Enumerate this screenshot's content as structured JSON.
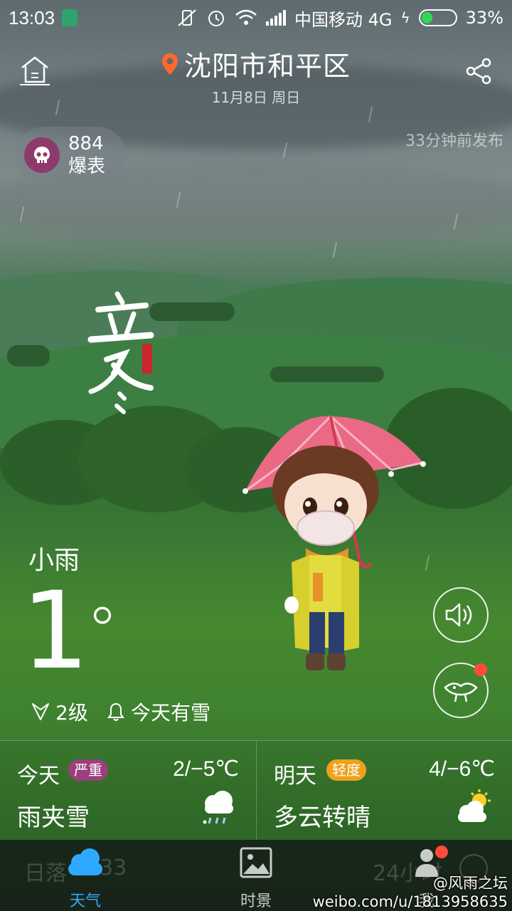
{
  "status_bar": {
    "time": "13:03",
    "carrier": "中国移动 4G",
    "battery": "33%",
    "battery_level": 0.33
  },
  "header": {
    "location": "沈阳市和平区",
    "date": "11月8日 周日",
    "published": "33分钟前发布"
  },
  "aqi": {
    "value": "884",
    "label": "爆表",
    "color": "#8e3a6a"
  },
  "solar_term": {
    "text": "立冬"
  },
  "current": {
    "condition": "小雨",
    "temperature": "1",
    "unit": "°",
    "wind": "2级",
    "alert": "今天有雪"
  },
  "forecast": [
    {
      "day": "今天",
      "badge": "严重",
      "badge_color": "#9b3f7e",
      "range": "2/−5℃",
      "desc": "雨夹雪",
      "icon": "sleet-icon"
    },
    {
      "day": "明天",
      "badge": "轻度",
      "badge_color": "#f0a11c",
      "range": "4/−6℃",
      "desc": "多云转晴",
      "icon": "partly-sunny-icon"
    }
  ],
  "tabbar": {
    "ghost_left": "日落",
    "ghost_left_num": "33",
    "ghost_right": "24小时",
    "tabs": [
      {
        "label": "天气",
        "icon": "cloud-icon",
        "active": true
      },
      {
        "label": "时景",
        "icon": "picture-icon",
        "active": false
      },
      {
        "label": "我",
        "icon": "person-icon",
        "active": false
      }
    ]
  },
  "watermark": {
    "line1": "@风雨之坛",
    "line2": "weibo.com/u/1813958635"
  },
  "colors": {
    "accent_blue": "#2ea9ff",
    "location_pin": "#ff6a2b",
    "notification": "#ff4b3a"
  }
}
